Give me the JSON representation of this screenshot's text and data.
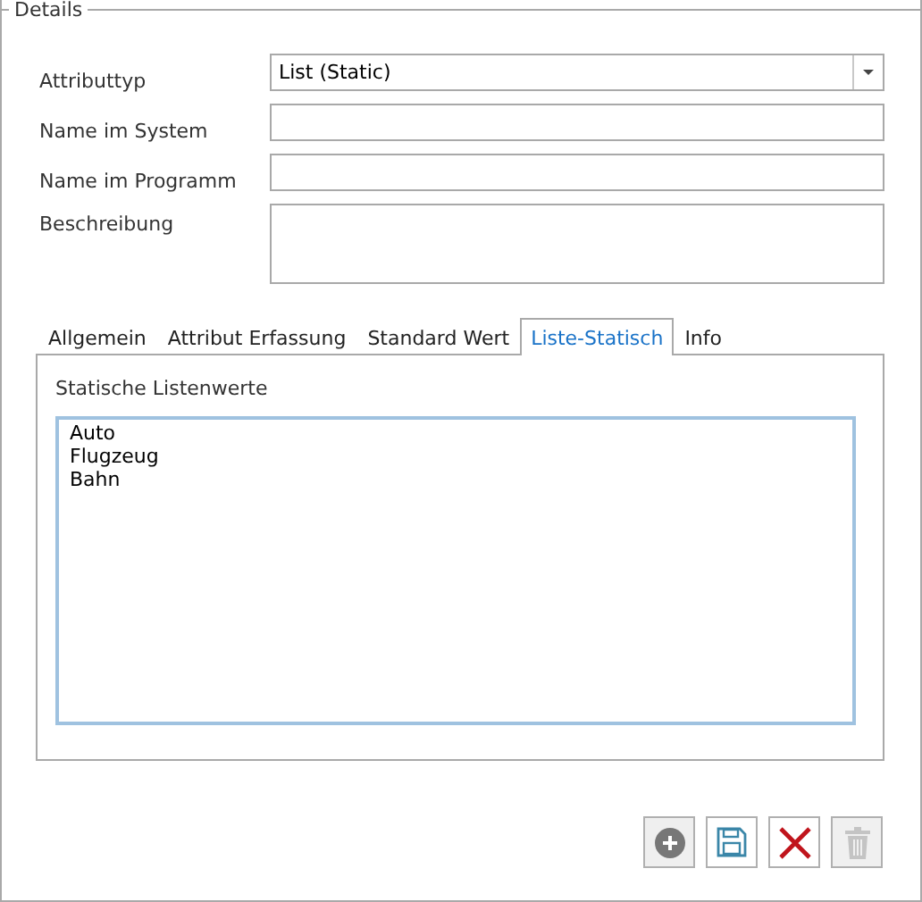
{
  "group": {
    "title": "Details"
  },
  "fields": [
    {
      "label": "Attributtyp",
      "kind": "dropdown",
      "value": "List (Static)"
    },
    {
      "label": "Name im System",
      "kind": "text"
    },
    {
      "label": "Name im Programm",
      "kind": "text"
    },
    {
      "label": "Beschreibung",
      "kind": "multiline"
    }
  ],
  "tabs": [
    {
      "label": "Allgemein",
      "selected": false
    },
    {
      "label": "Attribut Erfassung",
      "selected": false
    },
    {
      "label": "Standard Wert",
      "selected": false
    },
    {
      "label": "Liste-Statisch",
      "selected": true
    },
    {
      "label": "Info",
      "selected": false
    }
  ],
  "panel": {
    "label": "Statische Listenwerte",
    "lines": [
      "Auto",
      "Flugzeug",
      "Bahn"
    ]
  },
  "buttons": [
    {
      "kind": "add",
      "disabled": false
    },
    {
      "kind": "save",
      "disabled": false
    },
    {
      "kind": "delete",
      "disabled": false
    },
    {
      "kind": "trash",
      "disabled": true
    }
  ]
}
